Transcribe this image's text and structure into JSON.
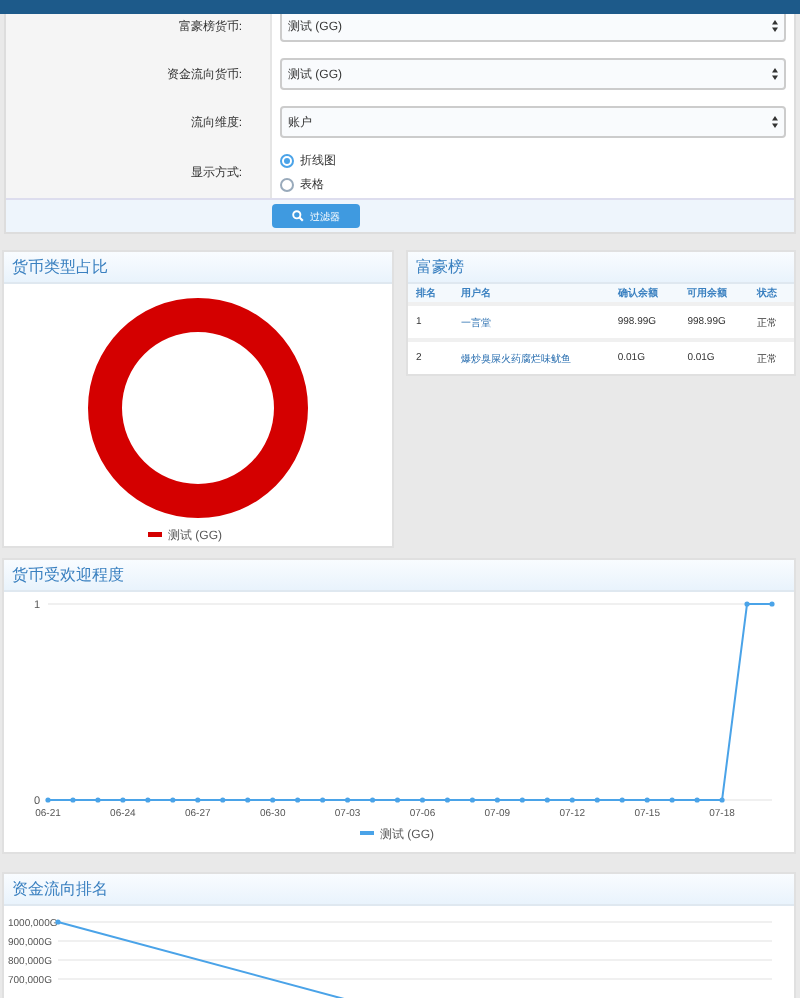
{
  "filter_form": {
    "fields": [
      {
        "label": "富豪榜货币:",
        "value": "测试 (GG)"
      },
      {
        "label": "资金流向货币:",
        "value": "测试 (GG)"
      },
      {
        "label": "流向维度:",
        "value": "账户"
      }
    ],
    "display_mode": {
      "label": "显示方式:",
      "options": [
        {
          "label": "折线图",
          "selected": true
        },
        {
          "label": "表格",
          "selected": false
        }
      ]
    },
    "filter_button": "过滤器"
  },
  "currency_share": {
    "title": "货币类型占比",
    "legend": [
      {
        "label": "测试 (GG)",
        "color": "#d40000"
      }
    ]
  },
  "rich_list": {
    "title": "富豪榜",
    "columns": [
      "排名",
      "用户名",
      "确认余额",
      "可用余额",
      "状态"
    ],
    "rows": [
      [
        "1",
        "一言堂",
        "998.99G",
        "998.99G",
        "正常"
      ],
      [
        "2",
        "爆炒臭屎火药腐烂味鱿鱼",
        "0.01G",
        "0.01G",
        "正常"
      ]
    ]
  },
  "popularity": {
    "title": "货币受欢迎程度",
    "chart_data": {
      "type": "line",
      "categories": [
        "06-21",
        null,
        null,
        "06-24",
        null,
        null,
        "06-27",
        null,
        null,
        "06-30",
        null,
        null,
        "07-03",
        null,
        null,
        "07-06",
        null,
        null,
        "07-09",
        null,
        null,
        "07-12",
        null,
        null,
        "07-15",
        null,
        null,
        "07-18",
        null,
        null
      ],
      "yticks": [
        0,
        1
      ],
      "ylim": [
        0,
        1
      ],
      "series": [
        {
          "name": "测试 (GG)",
          "color": "#4aa3e8",
          "values": [
            0,
            0,
            0,
            0,
            0,
            0,
            0,
            0,
            0,
            0,
            0,
            0,
            0,
            0,
            0,
            0,
            0,
            0,
            0,
            0,
            0,
            0,
            0,
            0,
            0,
            0,
            0,
            0,
            1,
            1
          ]
        }
      ]
    }
  },
  "flow_ranking": {
    "title": "资金流向排名",
    "y_axis_labels": [
      "1000,000G",
      "900,000G",
      "800,000G",
      "700,000G"
    ]
  }
}
